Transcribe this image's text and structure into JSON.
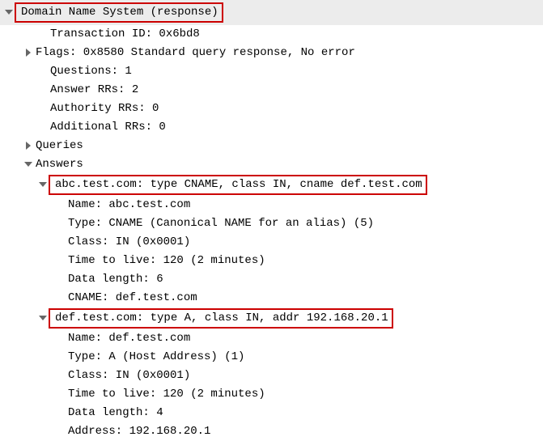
{
  "header": {
    "title": "Domain Name System (response)"
  },
  "fields": {
    "transaction_id": "Transaction ID: 0x6bd8",
    "flags": "Flags: 0x8580 Standard query response, No error",
    "questions": "Questions: 1",
    "answer_rrs": "Answer RRs: 2",
    "authority_rrs": "Authority RRs: 0",
    "additional_rrs": "Additional RRs: 0",
    "queries": "Queries",
    "answers": "Answers"
  },
  "answer1": {
    "summary": "abc.test.com: type CNAME, class IN, cname def.test.com",
    "name": "Name: abc.test.com",
    "type": "Type: CNAME (Canonical NAME for an alias) (5)",
    "class": "Class: IN (0x0001)",
    "ttl": "Time to live: 120 (2 minutes)",
    "datalen": "Data length: 6",
    "cname": "CNAME: def.test.com"
  },
  "answer2": {
    "summary": "def.test.com: type A, class IN, addr 192.168.20.1",
    "name": "Name: def.test.com",
    "type": "Type: A (Host Address) (1)",
    "class": "Class: IN (0x0001)",
    "ttl": "Time to live: 120 (2 minutes)",
    "datalen": "Data length: 4",
    "address": "Address: 192.168.20.1"
  }
}
